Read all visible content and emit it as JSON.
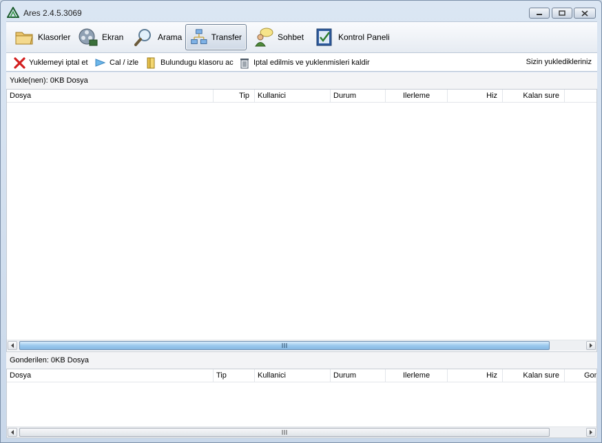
{
  "window": {
    "title": "Ares 2.4.5.3069"
  },
  "toolbar": {
    "items": [
      {
        "label": "Klasorler",
        "icon": "folder-icon"
      },
      {
        "label": "Ekran",
        "icon": "film-reel-icon"
      },
      {
        "label": "Arama",
        "icon": "magnifier-icon"
      },
      {
        "label": "Transfer",
        "icon": "network-transfer-icon",
        "active": true
      },
      {
        "label": "Sohbet",
        "icon": "chat-users-icon"
      },
      {
        "label": "Kontrol Paneli",
        "icon": "control-panel-icon"
      }
    ]
  },
  "actions": {
    "cancel_upload": "Yuklemeyi iptal et",
    "play": "Cal / izle",
    "open_folder": "Bulundugu klasoru ac",
    "remove_cancelled": "Iptal edilmis ve yuklenmisleri kaldir",
    "your_uploads": "Sizin yukledikleriniz"
  },
  "downloads": {
    "label": "Yukle(nen): 0KB Dosya",
    "columns": [
      "Dosya",
      "Tip",
      "Kullanici",
      "Durum",
      "Ilerleme",
      "Hiz",
      "Kalan sure"
    ],
    "rows": []
  },
  "uploads": {
    "label": "Gonderilen: 0KB Dosya",
    "columns": [
      "Dosya",
      "Tip",
      "Kullanici",
      "Durum",
      "Ilerleme",
      "Hiz",
      "Kalan sure",
      "Gon"
    ],
    "rows": []
  },
  "colors": {
    "accent": "#3b8fd6",
    "title_bg": "#cfdbe8"
  }
}
